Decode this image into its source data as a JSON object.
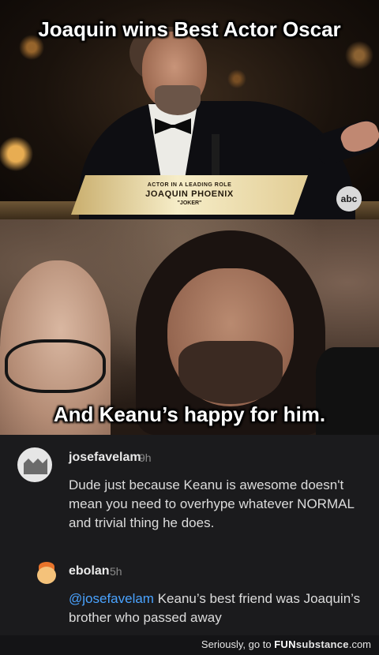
{
  "meme": {
    "top_caption": "Joaquin wins Best Actor Oscar",
    "bottom_caption": "And Keanu’s happy for him.",
    "lower_third": {
      "line1": "ACTOR IN A LEADING ROLE",
      "line2": "JOAQUIN PHOENIX",
      "line3": "\"JOKER\""
    },
    "network_logo": "abc"
  },
  "comments": [
    {
      "username": "josefavelam",
      "time": "9h",
      "text": "Dude just because Keanu is awesome doesn't mean you need to overhype whatever NORMAL and trivial thing he does."
    },
    {
      "username": "ebolan",
      "time": "5h",
      "mention": "@josefavelam",
      "text": " Keanu’s best friend was Joaquin’s brother who passed away"
    }
  ],
  "footer": {
    "prefix": "Seriously, go to ",
    "brand_bold": "FUN",
    "brand_rest": "substance",
    "suffix": ".com"
  }
}
